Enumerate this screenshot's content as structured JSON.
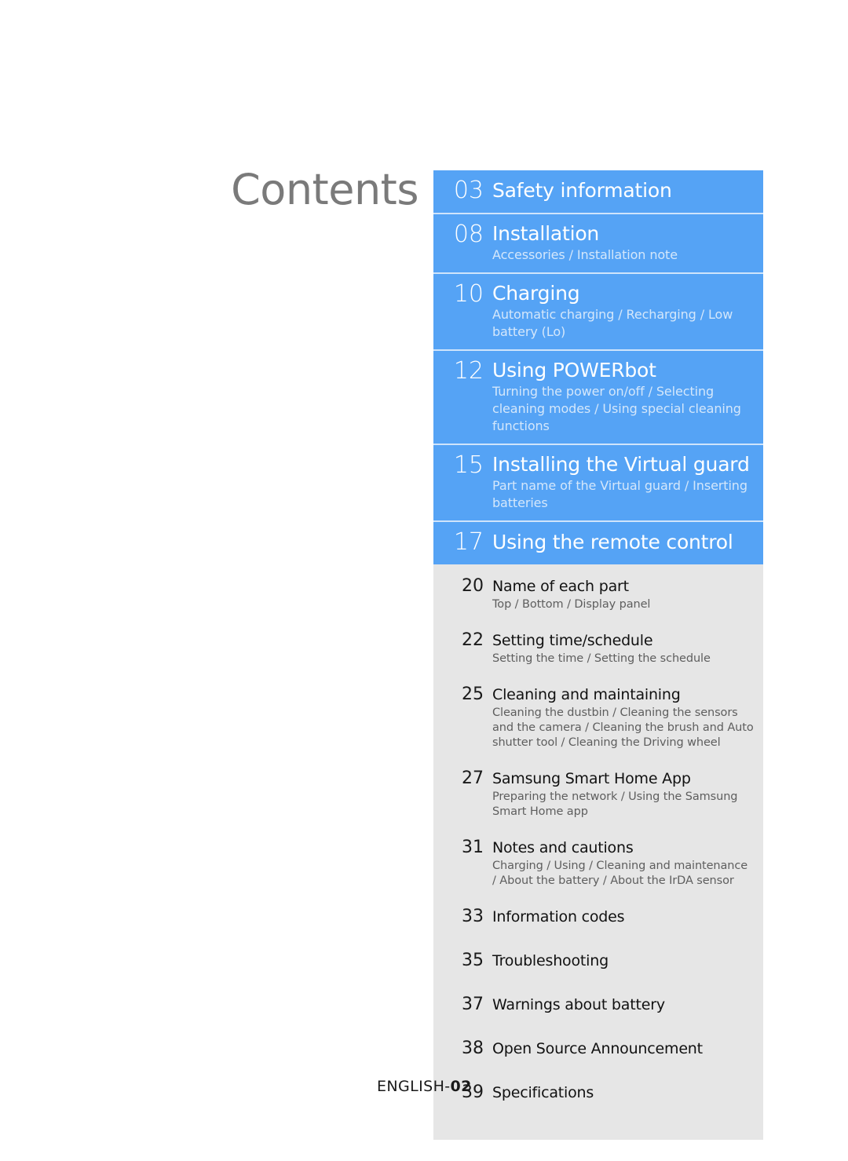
{
  "page": {
    "title": "Contents",
    "footer": {
      "language": "ENGLISH-",
      "page_number": "02"
    },
    "colors": {
      "accent_blue": "#55a3f5",
      "section_gray": "#e6e6e6",
      "title_gray": "#7a7a7a",
      "blue_divider": "#cfe4fb",
      "blue_subtext": "#d4e7fb"
    }
  },
  "toc": {
    "highlighted_entries": [
      {
        "page": "03",
        "title": "Safety information",
        "sub": ""
      },
      {
        "page": "08",
        "title": "Installation",
        "sub": "Accessories / Installation note"
      },
      {
        "page": "10",
        "title": "Charging",
        "sub": "Automatic charging / Recharging / Low battery (Lo)"
      },
      {
        "page": "12",
        "title": "Using POWERbot",
        "sub": "Turning the power on/off / Selecting cleaning modes / Using special cleaning functions"
      },
      {
        "page": "15",
        "title": "Installing the Virtual guard",
        "sub": "Part name of the Virtual guard / Inserting batteries"
      },
      {
        "page": "17",
        "title": "Using the remote control",
        "sub": ""
      }
    ],
    "standard_entries": [
      {
        "page": "20",
        "title": "Name of each part",
        "sub": "Top / Bottom / Display panel"
      },
      {
        "page": "22",
        "title": "Setting time/schedule",
        "sub": "Setting the time / Setting the schedule"
      },
      {
        "page": "25",
        "title": "Cleaning and maintaining",
        "sub": "Cleaning the dustbin / Cleaning the sensors and the camera / Cleaning the brush and Auto shutter tool / Cleaning the Driving wheel"
      },
      {
        "page": "27",
        "title": "Samsung Smart Home App",
        "sub": "Preparing the network / Using the Samsung Smart Home app"
      },
      {
        "page": "31",
        "title": "Notes and cautions",
        "sub": "Charging / Using / Cleaning and maintenance / About the battery / About the IrDA sensor"
      },
      {
        "page": "33",
        "title": "Information codes",
        "sub": ""
      },
      {
        "page": "35",
        "title": "Troubleshooting",
        "sub": ""
      },
      {
        "page": "37",
        "title": "Warnings about battery",
        "sub": ""
      },
      {
        "page": "38",
        "title": "Open Source Announcement",
        "sub": ""
      },
      {
        "page": "39",
        "title": "Specifications",
        "sub": ""
      }
    ]
  }
}
